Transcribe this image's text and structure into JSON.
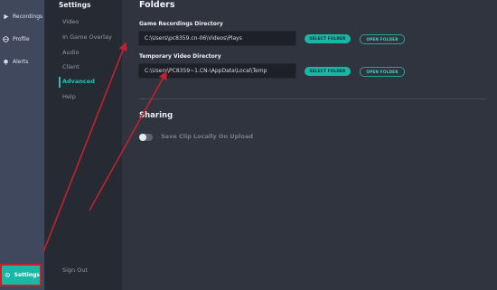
{
  "rail": {
    "items": [
      {
        "label": "Recordings",
        "icon": "play-icon"
      },
      {
        "label": "Profile",
        "icon": "globe-icon"
      },
      {
        "label": "Alerts",
        "icon": "bell-icon"
      }
    ],
    "settings_label": "Settings"
  },
  "subnav": {
    "title": "Settings",
    "items": [
      "Video",
      "In Game Overlay",
      "Audio",
      "Client",
      "Advanced",
      "Help"
    ],
    "active": "Advanced",
    "signout": "Sign Out"
  },
  "folders": {
    "heading": "Folders",
    "recordings": {
      "label": "Game Recordings Directory",
      "path": "C:\\Users\\pc8359.cn-06\\Videos\\Plays",
      "select_label": "SELECT FOLDER",
      "open_label": "OPEN FOLDER"
    },
    "temp": {
      "label": "Temporary Video Directory",
      "path": "C:\\Users\\PC8359~1.CN-\\AppData\\Local\\Temp",
      "select_label": "SELECT FOLDER",
      "open_label": "OPEN FOLDER"
    }
  },
  "sharing": {
    "heading": "Sharing",
    "toggle_label": "Save Clip Locally On Upload",
    "toggle_on": false
  },
  "colors": {
    "accent": "#19b6a6",
    "annotation": "#c2222f"
  }
}
